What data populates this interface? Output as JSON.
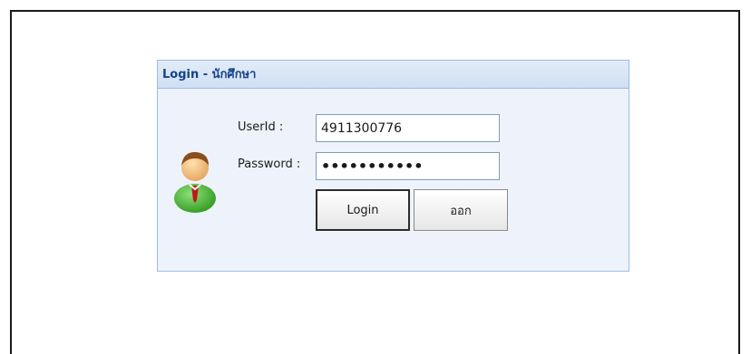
{
  "panel": {
    "title": "Login - นักศึกษา"
  },
  "form": {
    "userid_label": "UserId :",
    "userid_value": "4911300776",
    "password_label": "Password :",
    "password_value": "•••••••••••"
  },
  "buttons": {
    "login": "Login",
    "exit": "ออก"
  },
  "icons": {
    "avatar": "user-avatar-icon"
  },
  "colors": {
    "header_text": "#15428b",
    "panel_border": "#99bbe8",
    "panel_bg": "#eef3fb"
  }
}
